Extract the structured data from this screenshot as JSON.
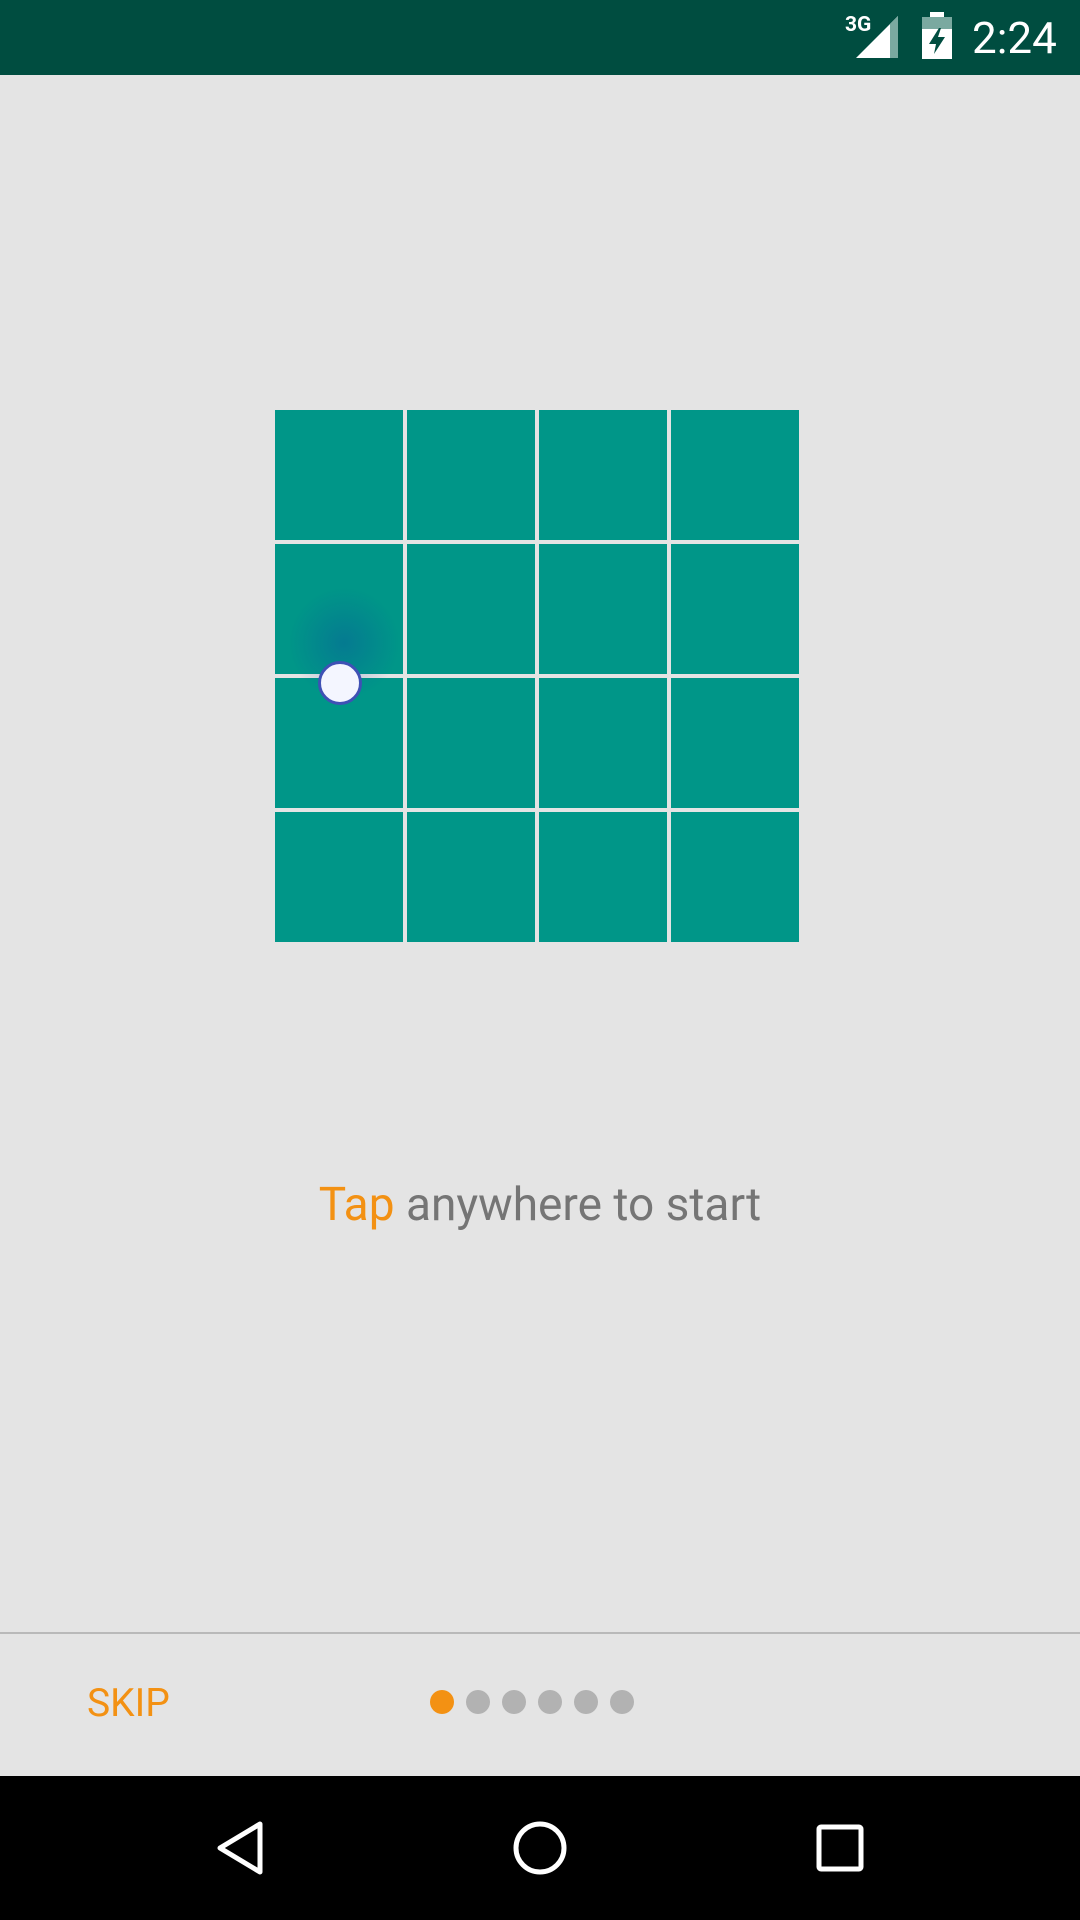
{
  "status_bar": {
    "network": "3G",
    "time": "2:24",
    "icons": [
      "signal-icon",
      "battery-charging-icon"
    ]
  },
  "grid": {
    "rows": 4,
    "cols": 4,
    "cell_color": "#009688",
    "touch_indicator": {
      "row": 1,
      "col": 0
    }
  },
  "hint": {
    "accent": "Tap",
    "rest": " anywhere to start"
  },
  "onboarding": {
    "skip_label": "SKIP",
    "page_count": 6,
    "active_page": 0,
    "accent_color": "#f39113"
  },
  "nav_bar": {
    "buttons": [
      "back-icon",
      "home-icon",
      "recents-icon"
    ]
  }
}
